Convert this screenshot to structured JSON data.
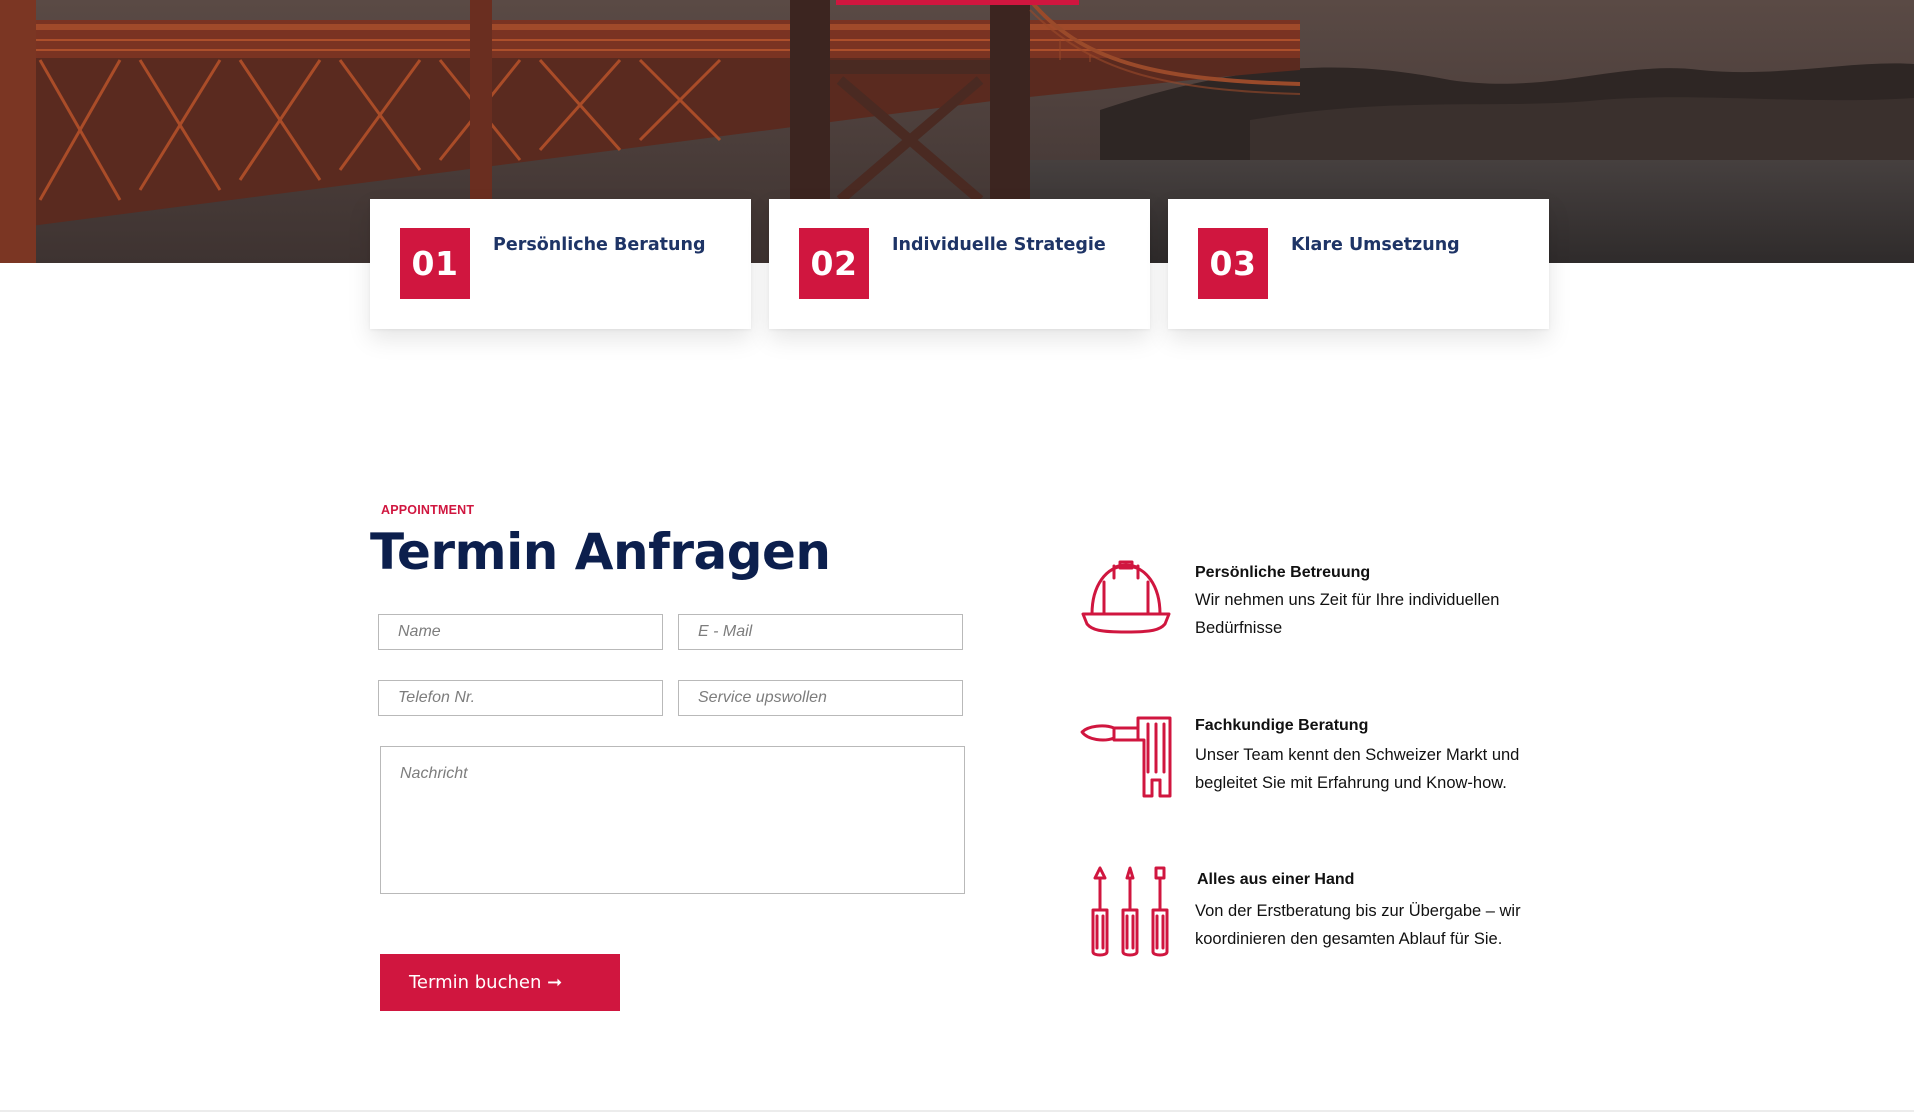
{
  "colors": {
    "accent": "#d0163f",
    "heading": "#0c1f4d",
    "card_title": "#1e3466"
  },
  "features": [
    {
      "number": "01",
      "title": "Persönliche Beratung"
    },
    {
      "number": "02",
      "title": "Individuelle Strategie"
    },
    {
      "number": "03",
      "title": "Klare Umsetzung"
    }
  ],
  "appointment": {
    "eyebrow": "APPOINTMENT",
    "title": "Termin Anfragen",
    "form": {
      "name_placeholder": "Name",
      "email_placeholder": "E - Mail",
      "phone_placeholder": "Telefon Nr.",
      "service_placeholder": "Service upswollen",
      "message_placeholder": "Nachricht",
      "submit_label": "Termin buchen ➞"
    }
  },
  "benefits": [
    {
      "icon": "hard-hat-icon",
      "title": "Persönliche Betreuung",
      "text": "Wir nehmen uns Zeit für Ihre individuellen Bedürfnisse"
    },
    {
      "icon": "paint-roller-icon",
      "title": "Fachkundige Beratung",
      "text": "Unser Team kennt den Schweizer Markt und begleitet Sie mit Erfahrung und Know-how."
    },
    {
      "icon": "screwdrivers-icon",
      "title": "Alles aus einer Hand",
      "text": "Von der Erstberatung bis zur Übergabe – wir koordinieren den gesamten Ablauf für Sie."
    }
  ]
}
